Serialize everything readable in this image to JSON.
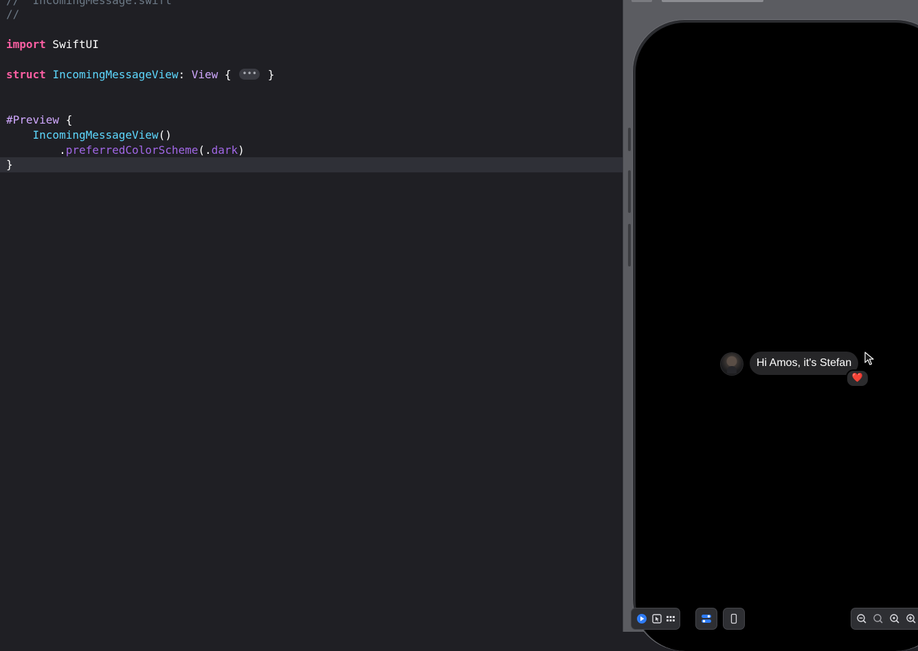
{
  "editor": {
    "lines": [
      {
        "id": "l0",
        "parts": [
          [
            "cmt",
            "//  IncomingMessage.swift"
          ]
        ]
      },
      {
        "id": "l1",
        "parts": [
          [
            "cmt",
            "//"
          ]
        ]
      },
      {
        "id": "l2",
        "parts": []
      },
      {
        "id": "l3",
        "parts": [
          [
            "kw",
            "import"
          ],
          [
            "",
            " SwiftUI"
          ]
        ]
      },
      {
        "id": "l4",
        "parts": []
      },
      {
        "id": "l5",
        "parts": [
          [
            "kw",
            "struct"
          ],
          [
            "",
            " "
          ],
          [
            "type",
            "IncomingMessageView"
          ],
          [
            "",
            ": "
          ],
          [
            "ref",
            "View"
          ],
          [
            "",
            " { "
          ],
          [
            "fold",
            "•••"
          ],
          [
            "",
            " }"
          ]
        ]
      },
      {
        "id": "l6",
        "parts": []
      },
      {
        "id": "l7",
        "parts": []
      },
      {
        "id": "l8",
        "parts": [
          [
            "macro",
            "#Preview"
          ],
          [
            "",
            " {"
          ]
        ]
      },
      {
        "id": "l9",
        "parts": [
          [
            "",
            "    "
          ],
          [
            "type2",
            "IncomingMessageView"
          ],
          [
            "",
            "()"
          ]
        ]
      },
      {
        "id": "l10",
        "parts": [
          [
            "",
            "        ."
          ],
          [
            "fn",
            "preferredColorScheme"
          ],
          [
            "",
            "(."
          ],
          [
            "fn",
            "dark"
          ],
          [
            "",
            ")"
          ]
        ]
      },
      {
        "id": "l11",
        "parts": [
          [
            "",
            "}"
          ]
        ]
      }
    ]
  },
  "preview": {
    "message_text": "Hi Amos, it's Stefan",
    "reaction": "❤️",
    "avatar_alt": "avatar"
  },
  "toolbar": {
    "live_icon": "play-circle-icon",
    "selectable_icon": "cursor-select-icon",
    "variants_icon": "grid-icon",
    "settings_icon": "toggle-settings-icon",
    "device_icon": "iphone-icon",
    "zoom_out_icon": "zoom-out-icon",
    "zoom_fit_icon": "zoom-fit-icon",
    "zoom_100_icon": "zoom-100-icon",
    "zoom_in_icon": "zoom-in-icon"
  },
  "colors": {
    "keyword": "#fc5fa3",
    "type": "#5dd8ff",
    "function": "#a167e6",
    "accent_blue": "#2f7cf6"
  }
}
